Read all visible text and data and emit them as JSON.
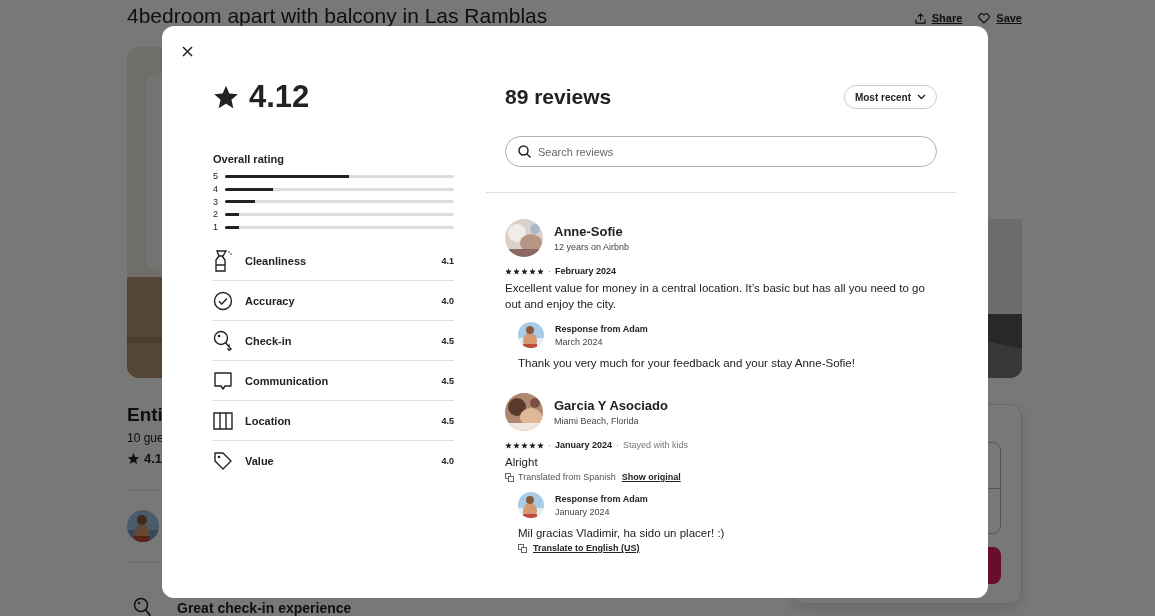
{
  "listing": {
    "title": "4bedroom apart with balcony in Las Ramblas",
    "actions": [
      {
        "label": "Share"
      },
      {
        "label": "Save"
      }
    ],
    "heading": "Enti",
    "guests": "10 gue",
    "rating": "4.1",
    "highlight": "Great check-in experience"
  },
  "reviews_dialog": {
    "rating": "4.12",
    "overall_rating": {
      "title": "Overall rating",
      "bars": [
        {
          "label": "5",
          "level": 0.54
        },
        {
          "label": "4",
          "level": 0.21
        },
        {
          "label": "3",
          "level": 0.13
        },
        {
          "label": "2",
          "level": 0.06
        },
        {
          "label": "1",
          "level": 0.06
        }
      ]
    },
    "categories": [
      {
        "name": "Cleanliness",
        "score": "4.1"
      },
      {
        "name": "Accuracy",
        "score": "4.0"
      },
      {
        "name": "Check-in",
        "score": "4.5"
      },
      {
        "name": "Communication",
        "score": "4.5"
      },
      {
        "name": "Location",
        "score": "4.5"
      },
      {
        "name": "Value",
        "score": "4.0"
      }
    ],
    "reviews_count": "89 reviews",
    "sort": "Most recent",
    "search": {
      "placeholder": "Search reviews"
    },
    "reviews": [
      {
        "name": "Anne-Sofie",
        "subtitle": "12 years on Airbnb",
        "stars": 5,
        "separator": "·",
        "date": "February 2024",
        "text": "Excellent value for money in a central location. It’s basic but has all you need to go out and enjoy the city.",
        "response": {
          "title": "Response from Adam",
          "date": "March 2024",
          "text": "Thank you very much for your feedback and your stay Anne-Sofie!"
        }
      },
      {
        "name": "Garcia Y Asociado",
        "subtitle": "Miami Beach, Florida",
        "stars": 5,
        "separator": "·",
        "date": "January 2024",
        "note_separator": "·",
        "note": "Stayed with kids",
        "text": "Alright",
        "translation": {
          "text": "Translated from Spanish",
          "link": "Show original"
        },
        "response": {
          "title": "Response from Adam",
          "date": "January 2024",
          "text": "Mil gracias Vladimir, ha sido un placer! :)",
          "translation_link": "Translate to English (US)"
        }
      }
    ]
  }
}
